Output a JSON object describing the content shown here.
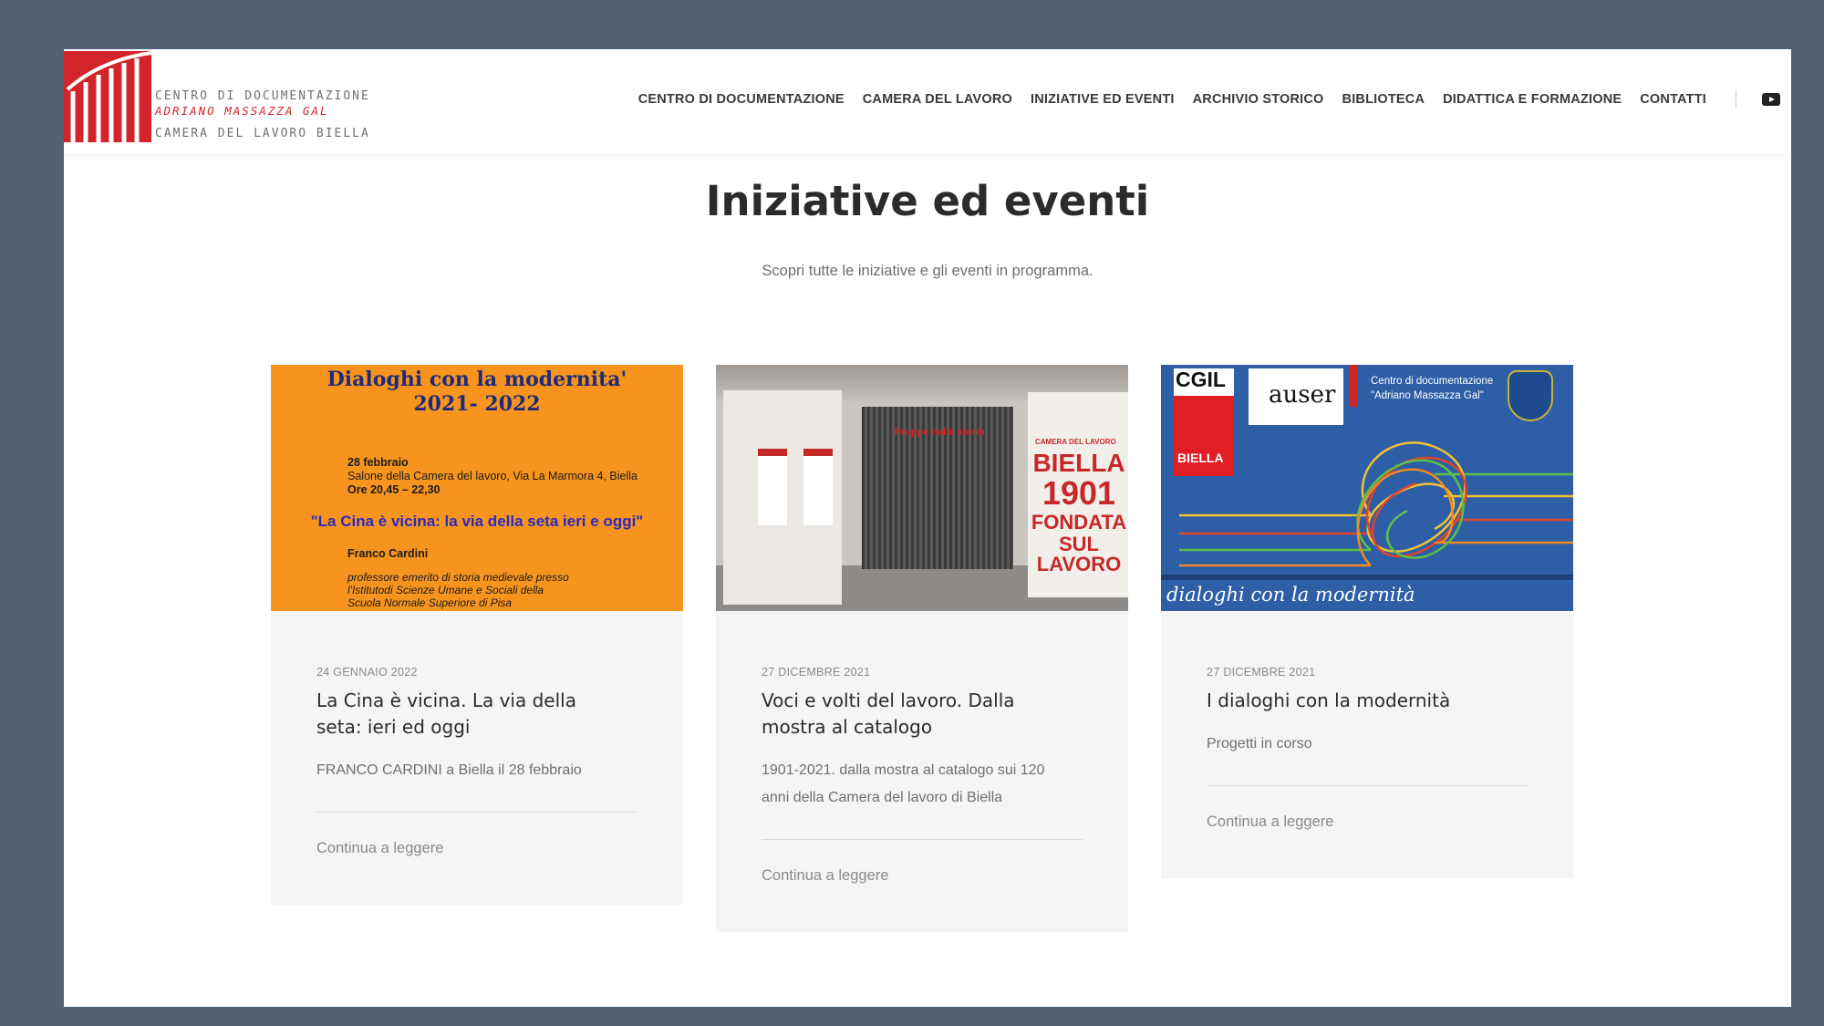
{
  "logo": {
    "line1": "CENTRO DI DOCUMENTAZIONE",
    "line2": "ADRIANO MASSAZZA GAL",
    "line3": "CAMERA DEL LAVORO BIELLA"
  },
  "nav": {
    "items": [
      "CENTRO DI DOCUMENTAZIONE",
      "CAMERA DEL LAVORO",
      "INIZIATIVE ED EVENTI",
      "ARCHIVIO STORICO",
      "BIBLIOTECA",
      "DIDATTICA E FORMAZIONE",
      "CONTATTI"
    ],
    "social_icon": "youtube-icon"
  },
  "page": {
    "title": "Iniziative ed eventi",
    "subtitle": "Scopri tutte le iniziative e gli eventi in programma."
  },
  "cards": [
    {
      "date": "24 GENNAIO 2022",
      "title": "La Cina è vicina. La via della seta: ieri ed oggi",
      "excerpt": "FRANCO CARDINI a Biella il 28 febbraio",
      "more": "Continua a leggere",
      "image": {
        "line1": "Dialoghi con la modernita'",
        "line2": "2021- 2022",
        "date": "28 febbraio",
        "place": "Salone della Camera del lavoro, Via La Marmora 4, Biella",
        "time": "Ore 20,45 – 22,30",
        "quote": "\"La Cina è vicina: la via della seta ieri e oggi\"",
        "speaker": "Franco Cardini",
        "bio1": "professore emerito di storia medievale presso",
        "bio2": "l'Istitutodi Scienze Umane e Sociali della",
        "bio3": "Scuola Normale Superiore di Pisa"
      }
    },
    {
      "date": "27 DICEMBRE 2021",
      "title": "Voci e volti del lavoro. Dalla mostra al catalogo",
      "excerpt": "1901-2021. dalla mostra al catalogo sui 120 anni della Camera del lavoro di Biella",
      "more": "Continua a leggere",
      "image": {
        "caption": "Pruppe nella storia",
        "label_small": "CAMERA DEL LAVORO",
        "l1": "BIELLA",
        "l2": "1901",
        "l3": "FONDATA",
        "l4": "SUL",
        "l5": "LAVORO"
      }
    },
    {
      "date": "27 DICEMBRE 2021",
      "title": "I dialoghi con la modernità",
      "excerpt": "Progetti in corso",
      "more": "Continua a leggere",
      "image": {
        "cgil": "CGIL",
        "biella": "BIELLA",
        "auser": "auser",
        "centro1": "Centro di documentazione",
        "centro2": "\"Adriano Massazza Gal\"",
        "tagline": "dialoghi con la modernità"
      }
    }
  ],
  "colors": {
    "background": "#526275",
    "brand_red": "#d3242b",
    "card_bg": "#f5f5f5",
    "poster_orange": "#f7941d",
    "poster_blue": "#2d5ea6"
  }
}
